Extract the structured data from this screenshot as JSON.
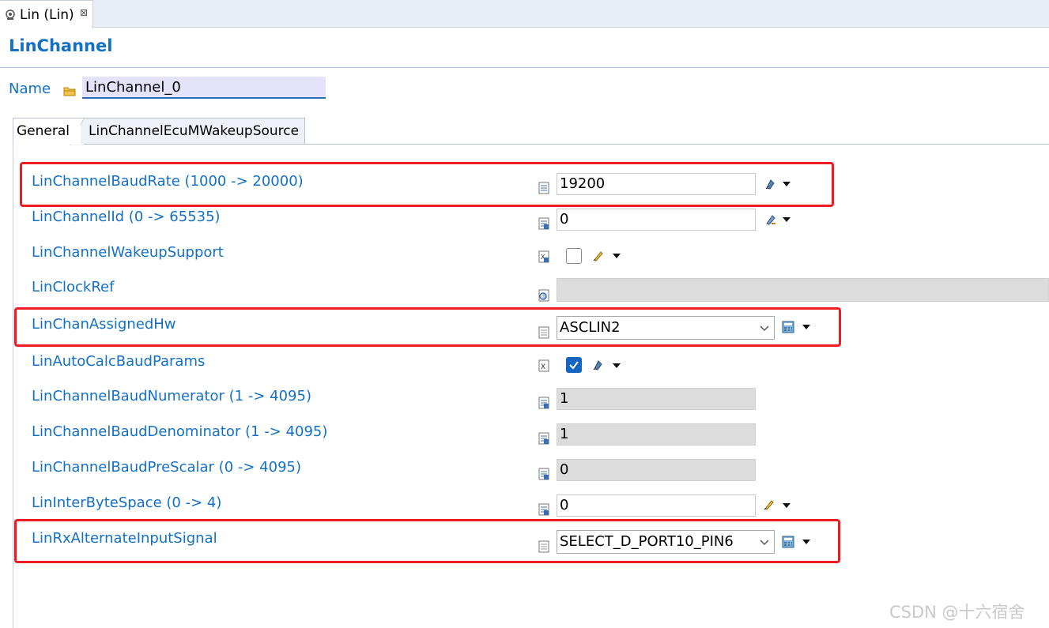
{
  "editor_tab": {
    "label": "Lin (Lin)",
    "close": "⊠"
  },
  "section": {
    "title": "LinChannel"
  },
  "name_row": {
    "label": "Name",
    "value": "LinChannel_0"
  },
  "inner_tabs": [
    {
      "label": "General",
      "active": true
    },
    {
      "label": "LinChannelEcuMWakeupSource",
      "active": false
    }
  ],
  "params": {
    "baud_rate": {
      "label": "LinChannelBaudRate (1000 -> 20000)",
      "value": "19200"
    },
    "channel_id": {
      "label": "LinChannelId (0 -> 65535)",
      "value": "0"
    },
    "wakeup_support": {
      "label": "LinChannelWakeupSupport",
      "checked": false
    },
    "clock_ref": {
      "label": "LinClockRef",
      "value": ""
    },
    "assigned_hw": {
      "label": "LinChanAssignedHw",
      "value": "ASCLIN2"
    },
    "auto_calc": {
      "label": "LinAutoCalcBaudParams",
      "checked": true
    },
    "numerator": {
      "label": "LinChannelBaudNumerator (1 -> 4095)",
      "value": "1"
    },
    "denominator": {
      "label": "LinChannelBaudDenominator (1 -> 4095)",
      "value": "1"
    },
    "prescalar": {
      "label": "LinChannelBaudPreScalar (0 -> 4095)",
      "value": "0"
    },
    "interbyte": {
      "label": "LinInterByteSpace (0 -> 4)",
      "value": "0"
    },
    "rx_alt": {
      "label": "LinRxAlternateInputSignal",
      "value": "SELECT_D_PORT10_PIN6"
    }
  },
  "colors": {
    "label_blue": "#1370c4",
    "highlight_red": "#ee1d23",
    "checkbox_blue": "#1565c0"
  },
  "watermark": "CSDN @十六宿舍"
}
